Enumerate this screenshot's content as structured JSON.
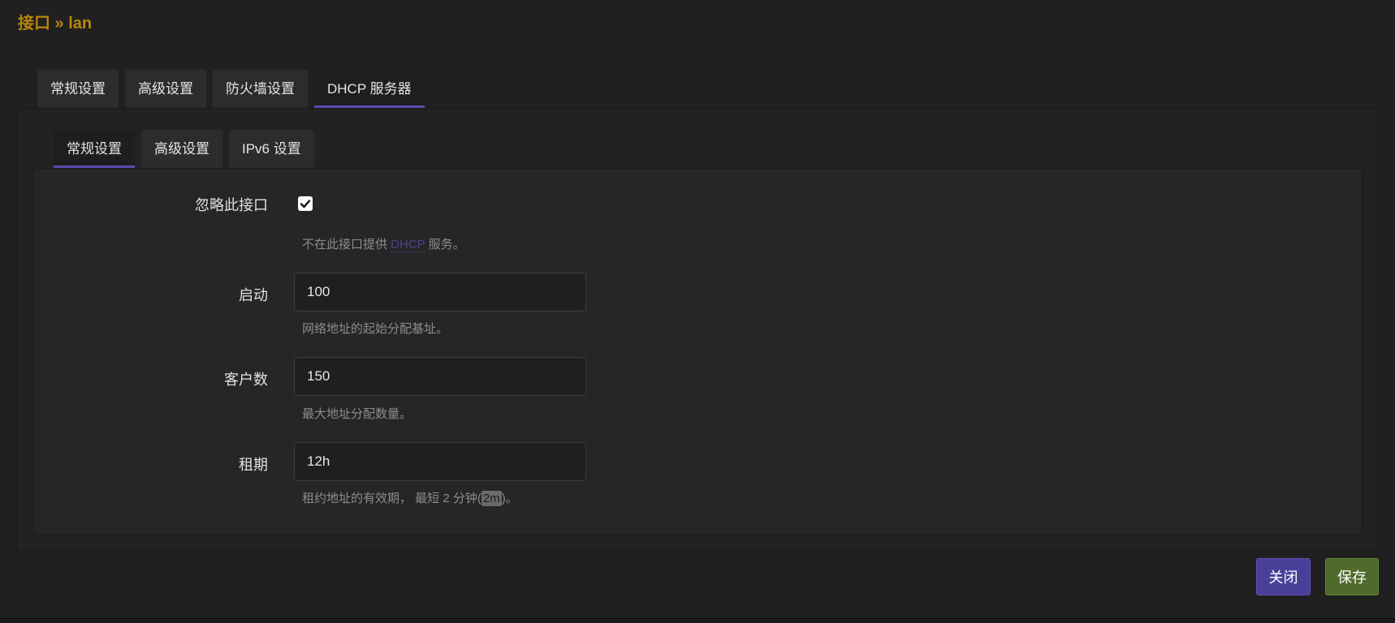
{
  "title": "接口 » lan",
  "main_tabs": [
    {
      "label": "常规设置",
      "active": false
    },
    {
      "label": "高级设置",
      "active": false
    },
    {
      "label": "防火墙设置",
      "active": false
    },
    {
      "label": "DHCP 服务器",
      "active": true
    }
  ],
  "sub_tabs": [
    {
      "label": "常规设置",
      "active": true
    },
    {
      "label": "高级设置",
      "active": false
    },
    {
      "label": "IPv6 设置",
      "active": false
    }
  ],
  "form": {
    "ignore": {
      "label": "忽略此接口",
      "checked": true,
      "desc_prefix": "不在此接口提供 ",
      "desc_abbr": "DHCP",
      "desc_suffix": " 服务。"
    },
    "start": {
      "label": "启动",
      "value": "100",
      "desc": "网络地址的起始分配基址。"
    },
    "limit": {
      "label": "客户数",
      "value": "150",
      "desc": "最大地址分配数量。"
    },
    "leasetime": {
      "label": "租期",
      "value": "12h",
      "desc_prefix": "租约地址的有效期， 最短 2 分钟(",
      "desc_code": "2m",
      "desc_suffix": ")。"
    }
  },
  "buttons": {
    "close": "关闭",
    "save": "保存"
  },
  "colors": {
    "accent": "#5a4bb0",
    "title": "#b8860b",
    "save": "#4f6b2c",
    "close": "#4a3f98"
  }
}
